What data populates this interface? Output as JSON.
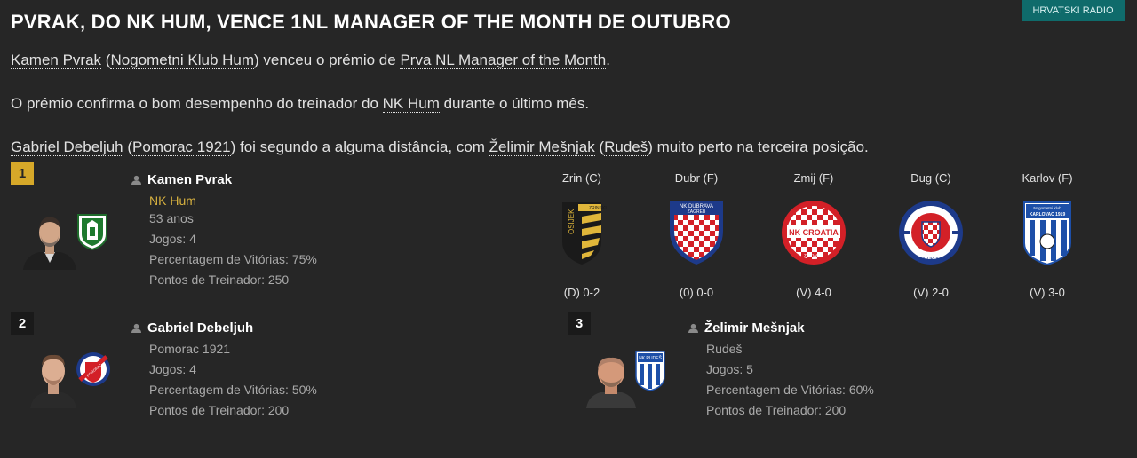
{
  "headline": "PVRAK, DO NK HUM, VENCE 1NL MANAGER OF THE MONTH DE OUTUBRO",
  "source_badge": "HRVATSKI RADIO",
  "paragraph1": {
    "manager": "Kamen Pvrak",
    "open_paren": " (",
    "club": "Nogometni Klub Hum",
    "mid": ") venceu o prémio de ",
    "award": "Prva NL Manager of the Month",
    "end": "."
  },
  "paragraph2": {
    "start": "O prémio confirma o bom desempenho do treinador do ",
    "club": "NK Hum",
    "end": " durante o último mês."
  },
  "paragraph3": {
    "second_manager": "Gabriel Debeljuh",
    "p1": " (",
    "second_club": "Pomorac 1921",
    "p2": ") foi segundo a alguma distância, com ",
    "third_manager": "Želimir Mešnjak",
    "p3": " (",
    "third_club": "Rudeš",
    "p4": ") muito perto na terceira posição."
  },
  "winner": {
    "rank": "1",
    "name": "Kamen Pvrak",
    "club": "NK Hum",
    "age": "53 anos",
    "games": "Jogos: 4",
    "win_pct": "Percentagem de Vitórias: 75%",
    "points": "Pontos de Treinador: 250",
    "rank_color": "#d6a829"
  },
  "fixtures": [
    {
      "opponent": "Zrin (C)",
      "result": "(D) 0-2",
      "badge": "zrinjski-osijek-crest"
    },
    {
      "opponent": "Dubr (F)",
      "result": "(0) 0-0",
      "badge": "nk-dubrava-zagreb-crest"
    },
    {
      "opponent": "Zmij (F)",
      "result": "(V) 4-0",
      "badge": "nk-croatia-zmijavci-crest"
    },
    {
      "opponent": "Dug (C)",
      "result": "(V) 2-0",
      "badge": "dugopolje-crest"
    },
    {
      "opponent": "Karlov (F)",
      "result": "(V) 3-0",
      "badge": "nk-karlovac-1919-crest"
    }
  ],
  "second": {
    "rank": "2",
    "name": "Gabriel Debeljuh",
    "club": "Pomorac 1921",
    "games": "Jogos: 4",
    "win_pct": "Percentagem de Vitórias: 50%",
    "points": "Pontos de Treinador: 200"
  },
  "third": {
    "rank": "3",
    "name": "Želimir Mešnjak",
    "club": "Rudeš",
    "games": "Jogos: 5",
    "win_pct": "Percentagem de Vitórias: 60%",
    "points": "Pontos de Treinador: 200"
  },
  "crest_texts": {
    "zrinjski": "OSIJEK",
    "zrinjski_top": "ZRINSKI",
    "dubrava_top": "NK DUBRAVA",
    "dubrava_city": "ZAGREB",
    "croatia_name": "NK CROATIA",
    "croatia_city": "ZMIJAVCI",
    "dugopolje": "DUGOPOLJE",
    "karlovac_top": "Nogometni klub",
    "karlovac_name": "KARLOVAC 1919",
    "pomorac": "POMORAC",
    "rudes": "NK RUDEŠ"
  },
  "colors": {
    "background": "#262626",
    "gold": "#d6a829",
    "badge": "#0f6b6b",
    "muted_text": "#a9a9a9"
  }
}
